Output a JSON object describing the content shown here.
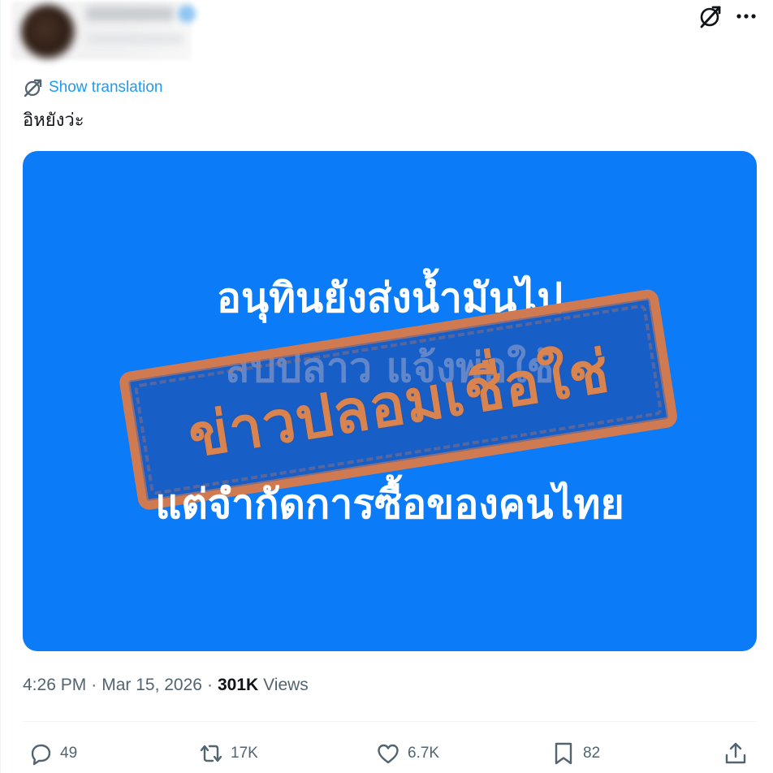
{
  "header": {
    "icons": [
      "grok-icon",
      "more-icon"
    ]
  },
  "translation": {
    "label": "Show translation"
  },
  "tweet": {
    "text": "อิหยังว่ะ"
  },
  "media": {
    "line1": "อนุทินยังส่งน้ำมันไป",
    "line2": "สปปลาว แจ้งพ่อใช้",
    "stamp": "ข่าวปลอมเชื่อใช่",
    "line3": "แต่จำกัดการซื้อของคนไทย",
    "background_color": "#0b7bf7",
    "stamp_color": "#cf7a51"
  },
  "meta": {
    "time": "4:26 PM",
    "separator": "·",
    "date": "Mar 15, 2026",
    "views_count": "301K",
    "views_label": "Views"
  },
  "actions": {
    "reply_count": "49",
    "retweet_count": "17K",
    "like_count": "6.7K",
    "bookmark_count": "82"
  },
  "colors": {
    "link": "#1d9bf0",
    "secondary_text": "#536471",
    "primary_text": "#0f1419"
  }
}
